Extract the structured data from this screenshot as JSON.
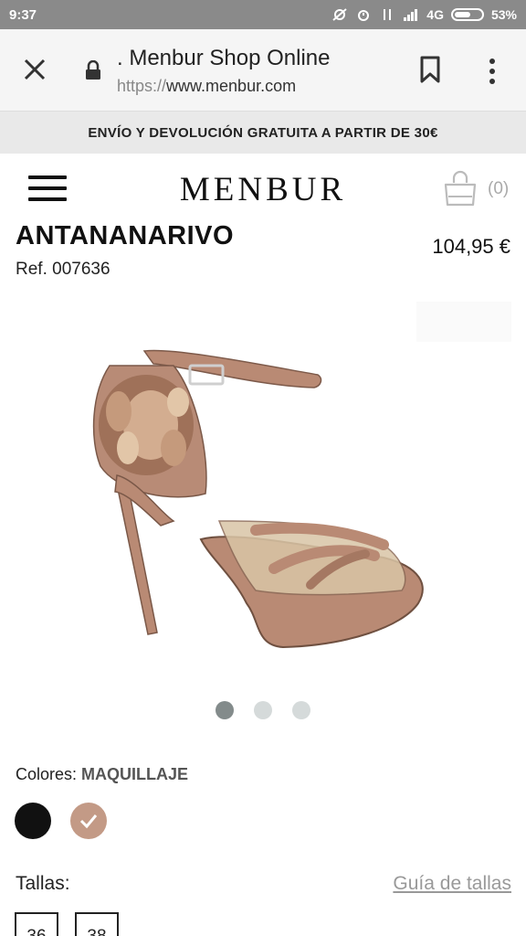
{
  "status_bar": {
    "time": "9:37",
    "network": "4G",
    "battery": "53%"
  },
  "browser": {
    "page_title": ". Menbur Shop Online",
    "url_scheme": "https://",
    "url_host": "www.menbur.com"
  },
  "promo": {
    "text": "ENVÍO Y DEVOLUCIÓN GRATUITA A PARTIR DE 30€"
  },
  "site": {
    "logo": "MENBUR",
    "cart_count": "(0)"
  },
  "product": {
    "name": "ANTANANARIVO",
    "price": "104,95 €",
    "ref": "Ref. 007636",
    "gallery": {
      "images": 3,
      "active_index": 0
    }
  },
  "colors": {
    "label": "Colores:",
    "selected": "MAQUILLAJE",
    "swatches": [
      {
        "name": "black",
        "hex": "#111111",
        "selected": false
      },
      {
        "name": "maquillaje",
        "hex": "#c39a86",
        "selected": true
      }
    ]
  },
  "sizes": {
    "label": "Tallas:",
    "guide_link": "Guía de tallas",
    "options": [
      "36",
      "38"
    ]
  }
}
